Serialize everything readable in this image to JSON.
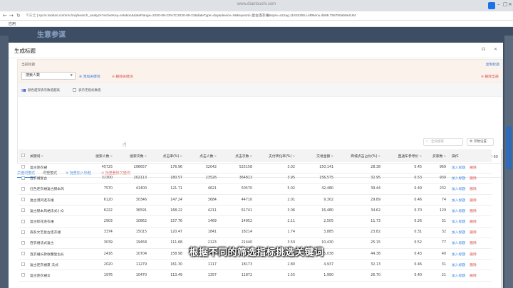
{
  "browser": {
    "watermark": "www.dianloushi.com",
    "secure_label": "不安全",
    "url": "sycm.taobao.com/mc/mq/search_analyze?activeKey=relation&dateRange=2020-08-23%7C2020-08-23&dateType=day&device=0&keyword=复古连衣裙&spm=a21ag.11815255.LeftMenu.d588.756750a59ezUM",
    "bookmark": "应用"
  },
  "background": {
    "title": "生意参谋"
  },
  "modal": {
    "title": "生成标题",
    "chosen_label": "当前标题",
    "chosen_right_link": "复制标题",
    "select_value": "搜索人数",
    "add_button": "添加关键词",
    "delete_button": "删除关键词",
    "clear_button": "删除全部",
    "legend_heat": "颜色越深表示数值越高",
    "legend_none": "表示无指标数值",
    "counter": "0 / 60"
  },
  "tabs": {
    "keyword_mode": "关键词模式",
    "phrase_mode": "词根模式",
    "batch_add": "批量加入标题",
    "batch_delete": "批量删除关键词"
  },
  "search": {
    "placeholder": "全局搜索"
  },
  "param_button": "参数设置",
  "table": {
    "columns": [
      "关键词",
      "搜索人数",
      "搜索次数",
      "点击率(%)",
      "点击人数",
      "点击次数",
      "支付转化率(%)",
      "交易金额",
      "商城点击占比(%)",
      "直通车参考价",
      "买家数",
      "操作"
    ],
    "rows": [
      [
        "复古连衣裙",
        "45725",
        "296657",
        "176.96",
        "32042",
        "525158",
        "3.02",
        "150,141",
        "28.38",
        "0.45",
        "969"
      ],
      [
        "连衣裙复古",
        "31300",
        "202113",
        "180.57",
        "23526",
        "364813",
        "3.95",
        "156,575",
        "32.95",
        "0.53",
        "930"
      ],
      [
        "红色连衣裙复古赫本风",
        "7570",
        "41400",
        "121.71",
        "4621",
        "50570",
        "5.02",
        "42,480",
        "39.44",
        "0.49",
        "232"
      ],
      [
        "复古港风连衣裙",
        "6120",
        "30346",
        "147.24",
        "3684",
        "44710",
        "2.01",
        "9,302",
        "29.89",
        "0.46",
        "74"
      ],
      [
        "复古赫本风裙法式小众",
        "6222",
        "36591",
        "168.22",
        "4211",
        "61741",
        "3.06",
        "16,480",
        "34.62",
        "0.70",
        "129"
      ],
      [
        "复古碎花连衣裙",
        "2903",
        "10862",
        "157.76",
        "1469",
        "14952",
        "2.11",
        "2,505",
        "11.73",
        "0.26",
        "31"
      ],
      [
        "森系文艺复古连衣裙",
        "3374",
        "15015",
        "120.47",
        "1841",
        "18214",
        "1.74",
        "3,885",
        "23.82",
        "0.31",
        "32"
      ],
      [
        "连衣裙法式复古",
        "3039",
        "19458",
        "111.68",
        "2123",
        "21440",
        "3.50",
        "10,430",
        "25.15",
        "0.52",
        "77"
      ],
      [
        "连衣裙长款收腰复古长",
        "2416",
        "10704",
        "158.98",
        "1426",
        "13208",
        "2.94",
        "5,038",
        "44.38",
        "0.43",
        "40"
      ],
      [
        "复古连衣裙夏 法式",
        "2020",
        "11279",
        "161.30",
        "1117",
        "18173",
        "2.80",
        "4,937",
        "32.13",
        "0.46",
        "31"
      ],
      [
        "复古连衣裙女",
        "1976",
        "10470",
        "113.49",
        "1357",
        "11872",
        "1.55",
        "1,990",
        "26.70",
        "0.40",
        "21"
      ]
    ],
    "add_label": "加入标题",
    "delete_label": "删除"
  },
  "subtitle": "根据不同的筛选指标挑选关键词"
}
